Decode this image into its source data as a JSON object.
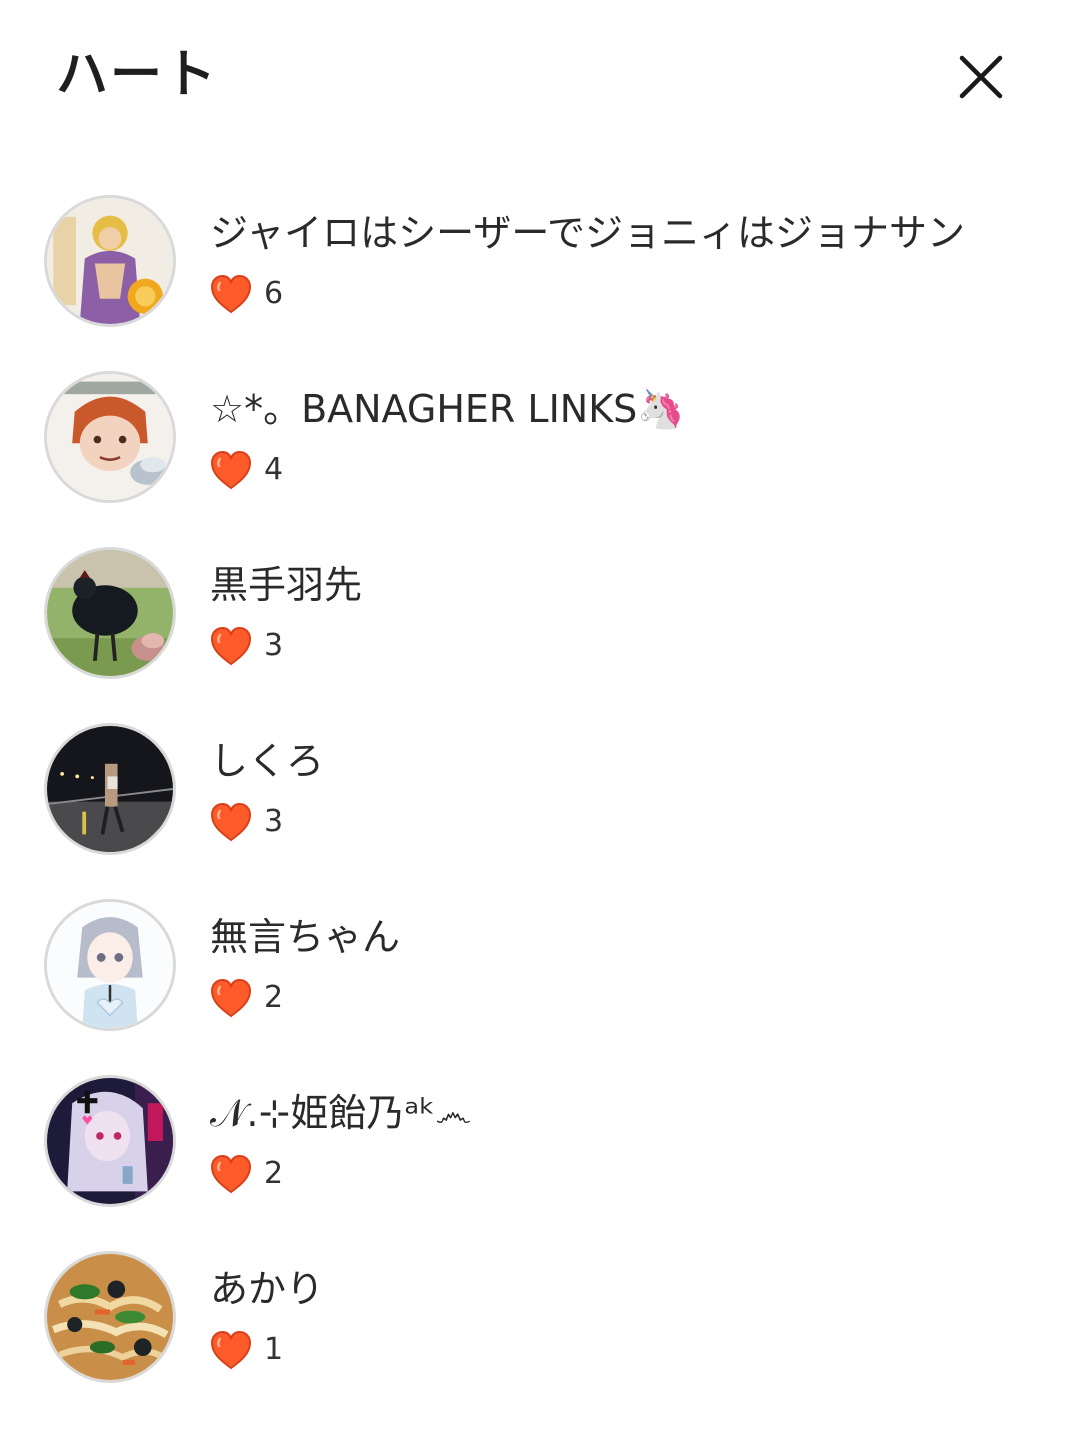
{
  "header": {
    "title": "ハート",
    "close_icon": "close-icon"
  },
  "colors": {
    "heart": "#ff5a2a",
    "heart_outline": "#d8401a",
    "avatar_border": "#d9d9d9"
  },
  "users": [
    {
      "name": "ジャイロはシーザーでジョニィはジョナサン",
      "hearts": "6",
      "avatar": "jojo-character-avatar"
    },
    {
      "name": "☆*。BANAGHER LINKS🦄",
      "hearts": "4",
      "avatar": "drawn-redhead-avatar"
    },
    {
      "name": "黒手羽先",
      "hearts": "3",
      "avatar": "black-rooster-avatar"
    },
    {
      "name": "しくろ",
      "hearts": "3",
      "avatar": "night-street-avatar"
    },
    {
      "name": "無言ちゃん",
      "hearts": "2",
      "avatar": "anime-girl-avatar"
    },
    {
      "name": "𝒩.⊹姫飴乃ᵃᵏ෴",
      "hearts": "2",
      "avatar": "purple-anime-avatar"
    },
    {
      "name": "あかり",
      "hearts": "1",
      "avatar": "noodle-dish-avatar"
    }
  ]
}
